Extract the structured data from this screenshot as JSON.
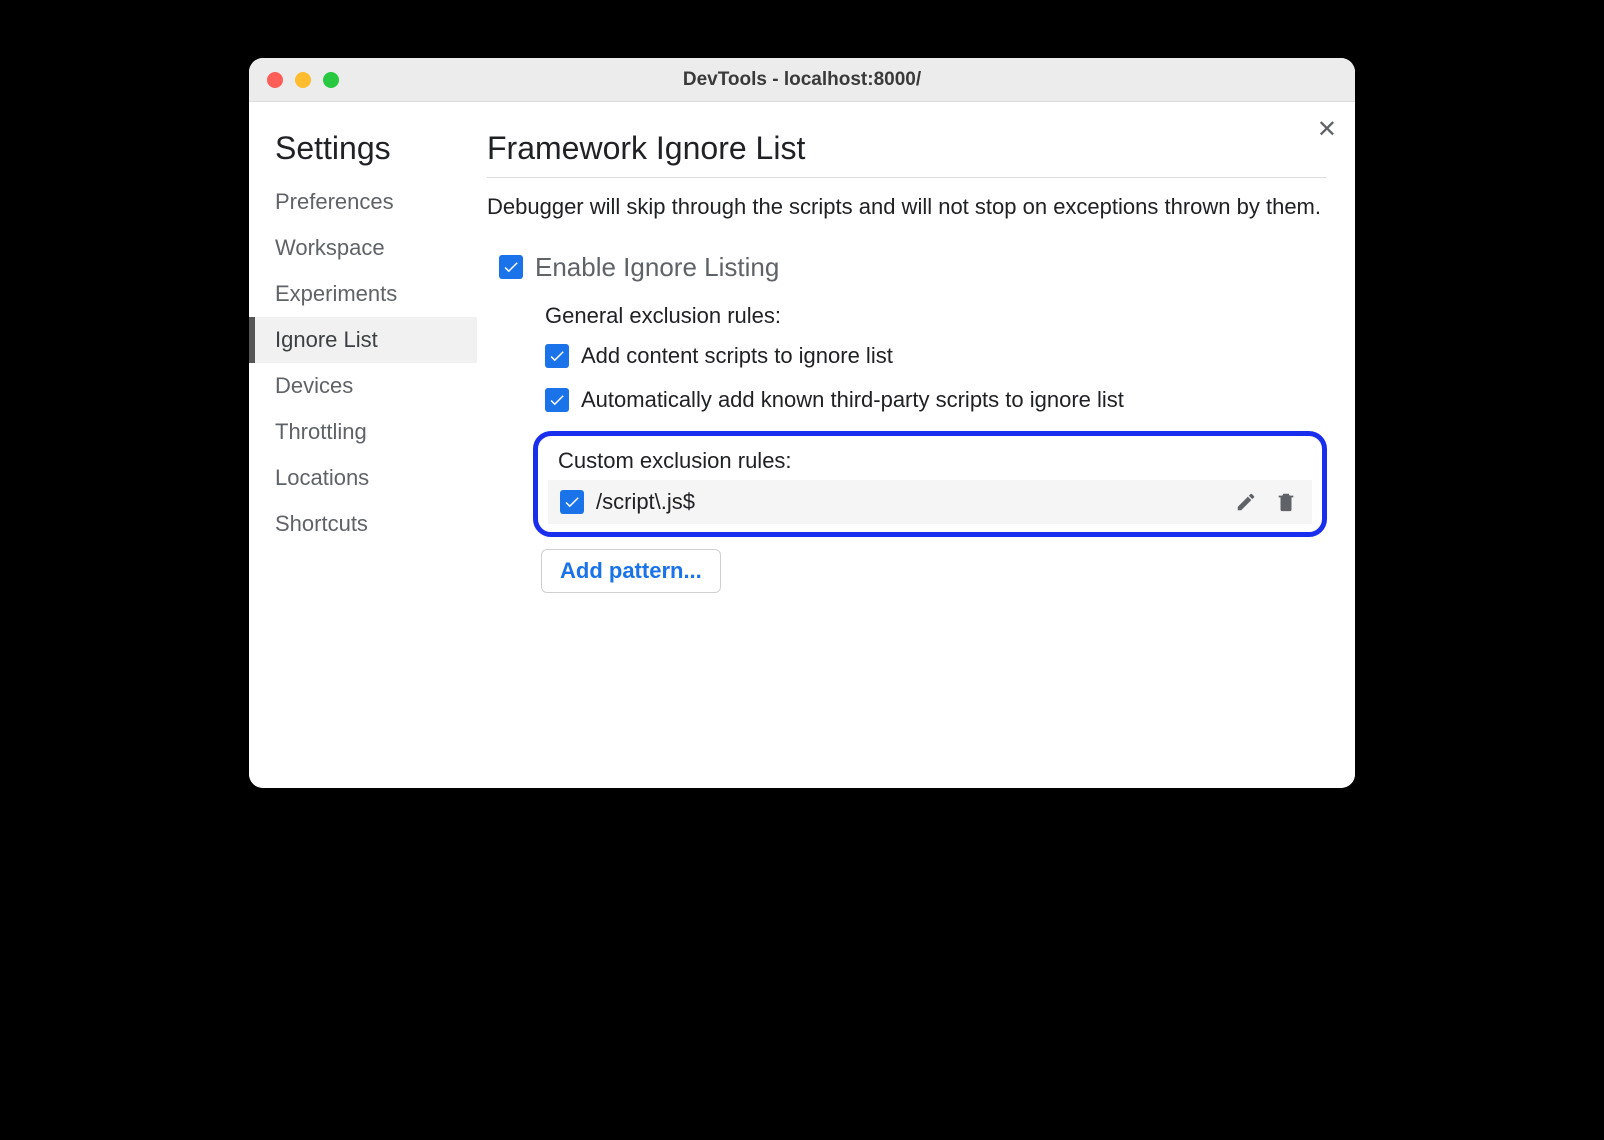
{
  "window": {
    "title": "DevTools - localhost:8000/"
  },
  "sidebar": {
    "title": "Settings",
    "items": [
      {
        "label": "Preferences",
        "selected": false
      },
      {
        "label": "Workspace",
        "selected": false
      },
      {
        "label": "Experiments",
        "selected": false
      },
      {
        "label": "Ignore List",
        "selected": true
      },
      {
        "label": "Devices",
        "selected": false
      },
      {
        "label": "Throttling",
        "selected": false
      },
      {
        "label": "Locations",
        "selected": false
      },
      {
        "label": "Shortcuts",
        "selected": false
      }
    ]
  },
  "main": {
    "title": "Framework Ignore List",
    "description": "Debugger will skip through the scripts and will not stop on exceptions thrown by them.",
    "enable": {
      "checked": true,
      "label": "Enable Ignore Listing"
    },
    "general": {
      "heading": "General exclusion rules:",
      "rules": [
        {
          "checked": true,
          "label": "Add content scripts to ignore list"
        },
        {
          "checked": true,
          "label": "Automatically add known third-party scripts to ignore list"
        }
      ]
    },
    "custom": {
      "heading": "Custom exclusion rules:",
      "rules": [
        {
          "checked": true,
          "pattern": "/script\\.js$"
        }
      ]
    },
    "addPatternLabel": "Add pattern..."
  }
}
